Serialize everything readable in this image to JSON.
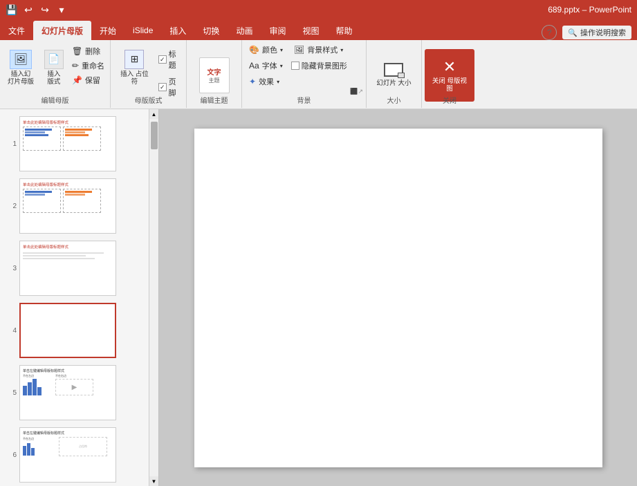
{
  "titleBar": {
    "filename": "689.pptx",
    "app": "PowerPoint",
    "separator": "–"
  },
  "ribbonTabs": [
    {
      "label": "文件",
      "active": false
    },
    {
      "label": "幻灯片母版",
      "active": true
    },
    {
      "label": "开始",
      "active": false
    },
    {
      "label": "iSlide",
      "active": false
    },
    {
      "label": "插入",
      "active": false
    },
    {
      "label": "切换",
      "active": false
    },
    {
      "label": "动画",
      "active": false
    },
    {
      "label": "审阅",
      "active": false
    },
    {
      "label": "视图",
      "active": false
    },
    {
      "label": "帮助",
      "active": false
    }
  ],
  "searchPlaceholder": "操作说明搜索",
  "ribbonGroups": {
    "editMaster": {
      "label": "编辑母版",
      "insertMaster": "插入幻\n灯片母版",
      "insertLayout": "插入版式",
      "delete": "删除",
      "rename": "重命名",
      "preserve": "保留"
    },
    "masterLayout": {
      "label": "母版版式",
      "insertPlaceholder": "插入\n占位符",
      "titleCheck": "标题",
      "footerCheck": "页脚"
    },
    "editTheme": {
      "label": "编辑主题",
      "themeLabel": "主题"
    },
    "background": {
      "label": "背景",
      "colors": "颜色",
      "fonts": "字体",
      "effects": "效果",
      "backgroundStyle": "背景样式",
      "hideBg": "隐藏背景图形"
    },
    "size": {
      "label": "大小",
      "slideSize": "幻灯片\n大小"
    },
    "close": {
      "label": "关闭",
      "closeMaster": "关闭\n母版视图"
    }
  },
  "slides": [
    {
      "number": 1,
      "type": "content",
      "selected": false,
      "blank": false
    },
    {
      "number": 2,
      "type": "content",
      "selected": false,
      "blank": false
    },
    {
      "number": 3,
      "type": "simple",
      "selected": false,
      "blank": false
    },
    {
      "number": 4,
      "type": "blank",
      "selected": true,
      "blank": true
    },
    {
      "number": 5,
      "type": "content2",
      "selected": false,
      "blank": false
    },
    {
      "number": 6,
      "type": "content3",
      "selected": false,
      "blank": false
    }
  ]
}
